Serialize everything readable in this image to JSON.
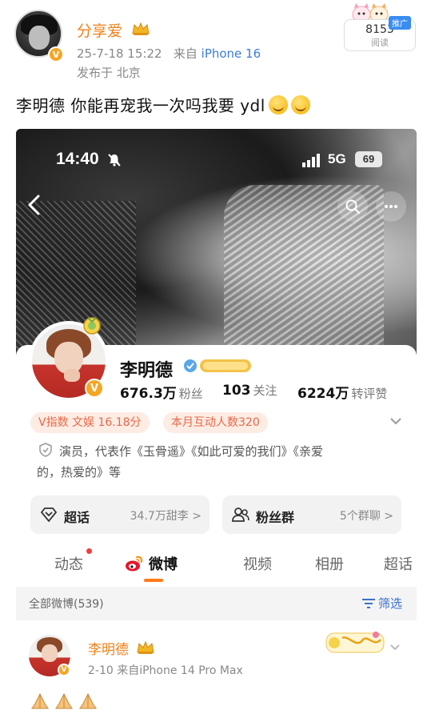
{
  "post": {
    "poster_name": "分享爱",
    "timestamp": "25-7-18 15:22",
    "source_prefix": "来自",
    "source_device": "iPhone 16",
    "location": "发布于 北京",
    "read_count": "8153",
    "read_label": "阅读",
    "promo_tag": "推广",
    "text": "李明德 你能再宠我一次吗我要 ydl"
  },
  "screenshot": {
    "status_bar": {
      "time": "14:40",
      "network": "5G",
      "battery": "69"
    },
    "profile": {
      "name": "李明德",
      "verify_mark": "V",
      "stats": [
        {
          "value": "676.3万",
          "label": "粉丝"
        },
        {
          "value": "103",
          "label": "关注"
        },
        {
          "value": "6224万",
          "label": "转评赞"
        }
      ],
      "chips": [
        "V指数 文娱 16.18分",
        "本月互动人数320"
      ],
      "bio_line1": "演员，代表作《玉骨遥》《如此可爱的我们》《亲爱",
      "bio_line2": "的，热爱的》等"
    },
    "cards": [
      {
        "title": "超话",
        "value": "34.7万甜李 >"
      },
      {
        "title": "粉丝群",
        "value": "5个群聊 >"
      }
    ],
    "tabs": [
      "动态",
      "微博",
      "视频",
      "相册",
      "超话"
    ],
    "filter": {
      "all": "全部微博(539)",
      "button": "筛选"
    },
    "latest_post": {
      "name": "李明德",
      "meta": "2-10  来自iPhone 14 Pro Max"
    }
  },
  "colors": {
    "orange_name": "#f0811a",
    "verified_gold": "#f5a623",
    "link_blue": "#3b7dd8",
    "tab_accent": "#ff7a1a"
  }
}
